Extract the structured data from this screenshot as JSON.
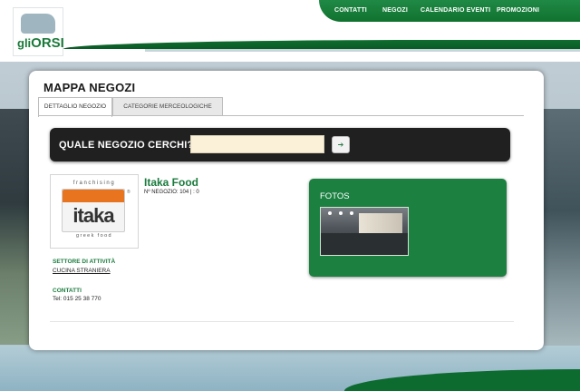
{
  "brand": {
    "logo_small": "gli",
    "logo_big": "ORSI"
  },
  "nav": {
    "items": [
      "CONTATTI",
      "NEGOZI",
      "CALENDARIO EVENTI",
      "PROMOZIONI"
    ]
  },
  "page": {
    "title": "MAPPA NEGOZI"
  },
  "tabs": [
    {
      "label": "DETTAGLIO NEGOZIO",
      "active": true
    },
    {
      "label": "CATEGORIE MERCEOLOGICHE",
      "active": false
    }
  ],
  "search": {
    "label": "QUALE NEGOZIO CERCHI?",
    "value": "",
    "button_glyph": "➔"
  },
  "store": {
    "logo": {
      "top_text": "franchising",
      "word": "itaka",
      "bottom_text": "greek food",
      "reg": "®"
    },
    "name": "Itaka Food",
    "meta": "Nº NEGOZIO: 104 | : 0",
    "sector_label": "SETTORE DI ATTIVITÀ",
    "sector_value": "CUCINA STRANIERA",
    "contacts_label": "CONTATTI",
    "phone": "Tel: 015 25 38 770"
  },
  "fotos": {
    "title": "FOTOS"
  },
  "colors": {
    "brand_green": "#1c7b3f",
    "search_bg": "#202020",
    "input_bg": "#fbf1d8",
    "accent_orange": "#e8741f"
  },
  "icons": {
    "search_button": "arrow-right-icon",
    "logo": "bear-icon"
  }
}
